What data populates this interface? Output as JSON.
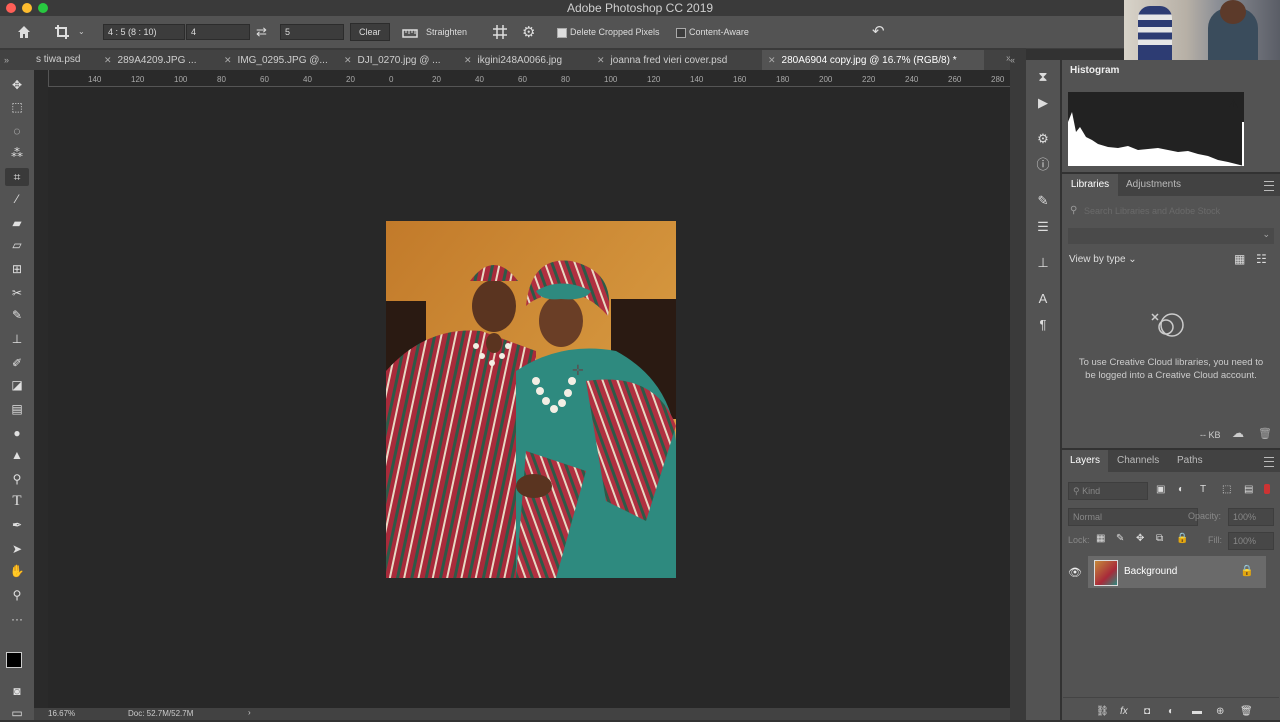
{
  "window": {
    "title": "Adobe Photoshop CC 2019"
  },
  "options_bar": {
    "ratio_preset": "4 : 5 (8 : 10)",
    "ratio_w": "4",
    "ratio_h": "5",
    "clear_label": "Clear",
    "straighten_label": "Straighten",
    "delete_cropped_label": "Delete Cropped Pixels",
    "delete_cropped_checked": true,
    "content_aware_label": "Content-Aware",
    "content_aware_checked": false
  },
  "tabs": [
    {
      "label": "s tiwa.psd"
    },
    {
      "label": "289A4209.JPG ..."
    },
    {
      "label": "IMG_0295.JPG @..."
    },
    {
      "label": "DJI_0270.jpg @ ..."
    },
    {
      "label": "ikgini248A0066.jpg"
    },
    {
      "label": "joanna fred vieri cover.psd"
    },
    {
      "label": "280A6904 copy.jpg @ 16.7% (RGB/8) *",
      "active": true
    }
  ],
  "ruler_h_labels": [
    "140",
    "120",
    "100",
    "80",
    "60",
    "40",
    "20",
    "0",
    "20",
    "40",
    "60",
    "80",
    "100",
    "120",
    "140",
    "160",
    "180",
    "200",
    "220",
    "240",
    "260",
    "280"
  ],
  "status": {
    "zoom": "16.67%",
    "doc": "Doc: 52.7M/52.7M"
  },
  "histogram": {
    "title": "Histogram"
  },
  "libraries": {
    "tab_libraries": "Libraries",
    "tab_adjustments": "Adjustments",
    "search_placeholder": "Search Libraries and Adobe Stock",
    "view_by": "View by type",
    "message": "To use Creative Cloud libraries, you need to be logged into a Creative Cloud account.",
    "size": "-- KB"
  },
  "layers_panel": {
    "tab_layers": "Layers",
    "tab_channels": "Channels",
    "tab_paths": "Paths",
    "kind_placeholder": "Kind",
    "blend_mode": "Normal",
    "opacity_label": "Opacity:",
    "opacity_value": "100%",
    "lock_label": "Lock:",
    "fill_label": "Fill:",
    "fill_value": "100%",
    "layers": [
      {
        "name": "Background"
      }
    ]
  },
  "colors": {
    "accent": "#535353",
    "canvas": "#282828",
    "panel": "#535353"
  }
}
